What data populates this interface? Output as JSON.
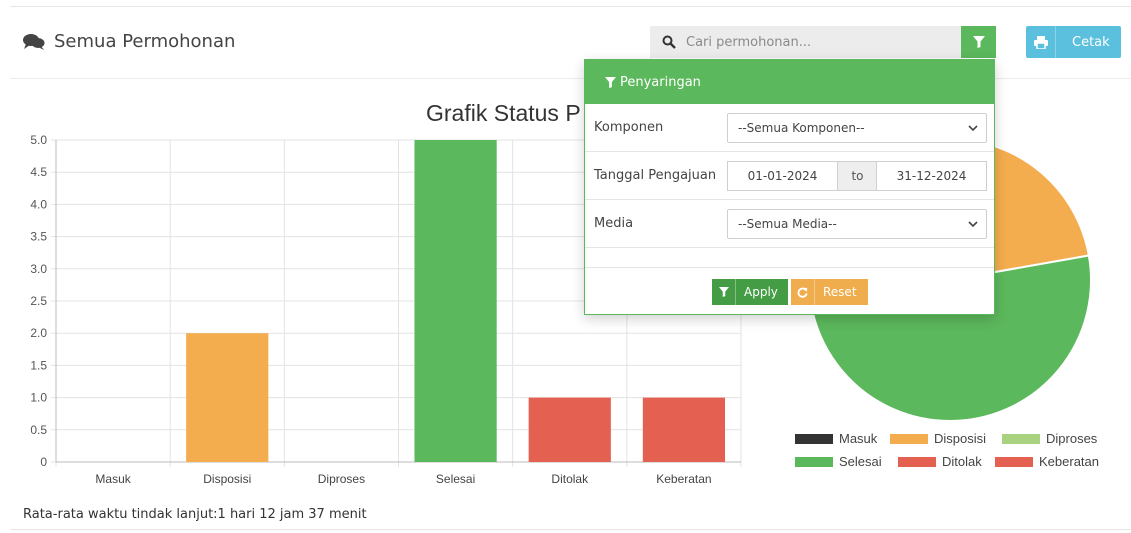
{
  "header": {
    "title": "Semua Permohonan",
    "search_placeholder": "Cari permohonan...",
    "print_label": "Cetak"
  },
  "chart_title": "Grafik Status P",
  "chart_data": [
    {
      "type": "bar",
      "categories": [
        "Masuk",
        "Disposisi",
        "Diproses",
        "Selesai",
        "Ditolak",
        "Keberatan"
      ],
      "values": [
        0,
        2,
        0,
        5,
        1,
        1
      ],
      "colors": [
        "#333333",
        "#f4ad4e",
        "#a8d27f",
        "#5cb85c",
        "#e46050",
        "#e46050"
      ],
      "ylim": [
        0,
        5
      ],
      "yticks": [
        "0",
        "0.5",
        "1.0",
        "1.5",
        "2.0",
        "2.5",
        "3.0",
        "3.5",
        "4.0",
        "4.5",
        "5.0"
      ],
      "grid": true
    },
    {
      "type": "pie",
      "labels": [
        "Masuk",
        "Disposisi",
        "Diproses",
        "Selesai",
        "Ditolak",
        "Keberatan"
      ],
      "values": [
        0,
        2,
        0,
        5,
        1,
        1
      ],
      "colors": [
        "#333333",
        "#f4ad4e",
        "#a8d27f",
        "#5cb85c",
        "#e46050",
        "#e46050"
      ],
      "legend_position": "bottom"
    }
  ],
  "legend": [
    {
      "label": "Masuk",
      "color": "#333333"
    },
    {
      "label": "Disposisi",
      "color": "#f4ad4e"
    },
    {
      "label": "Diproses",
      "color": "#a8d27f"
    },
    {
      "label": "Selesai",
      "color": "#5cb85c"
    },
    {
      "label": "Ditolak",
      "color": "#e46050"
    },
    {
      "label": "Keberatan",
      "color": "#e46050"
    }
  ],
  "footer": {
    "avg_text": "Rata-rata waktu tindak lanjut:1 hari 12 jam 37 menit"
  },
  "filter": {
    "title": "Penyaringan",
    "komponen_label": "Komponen",
    "komponen_value": "--Semua Komponen--",
    "tanggal_label": "Tanggal Pengajuan",
    "date_from": "01-01-2024",
    "date_to_label": "to",
    "date_to": "31-12-2024",
    "media_label": "Media",
    "media_value": "--Semua Media--",
    "apply_label": "Apply",
    "reset_label": "Reset"
  },
  "colors": {
    "primary_green": "#5cb85c",
    "info_blue": "#5bc0de",
    "warning_orange": "#f0ad4e"
  }
}
